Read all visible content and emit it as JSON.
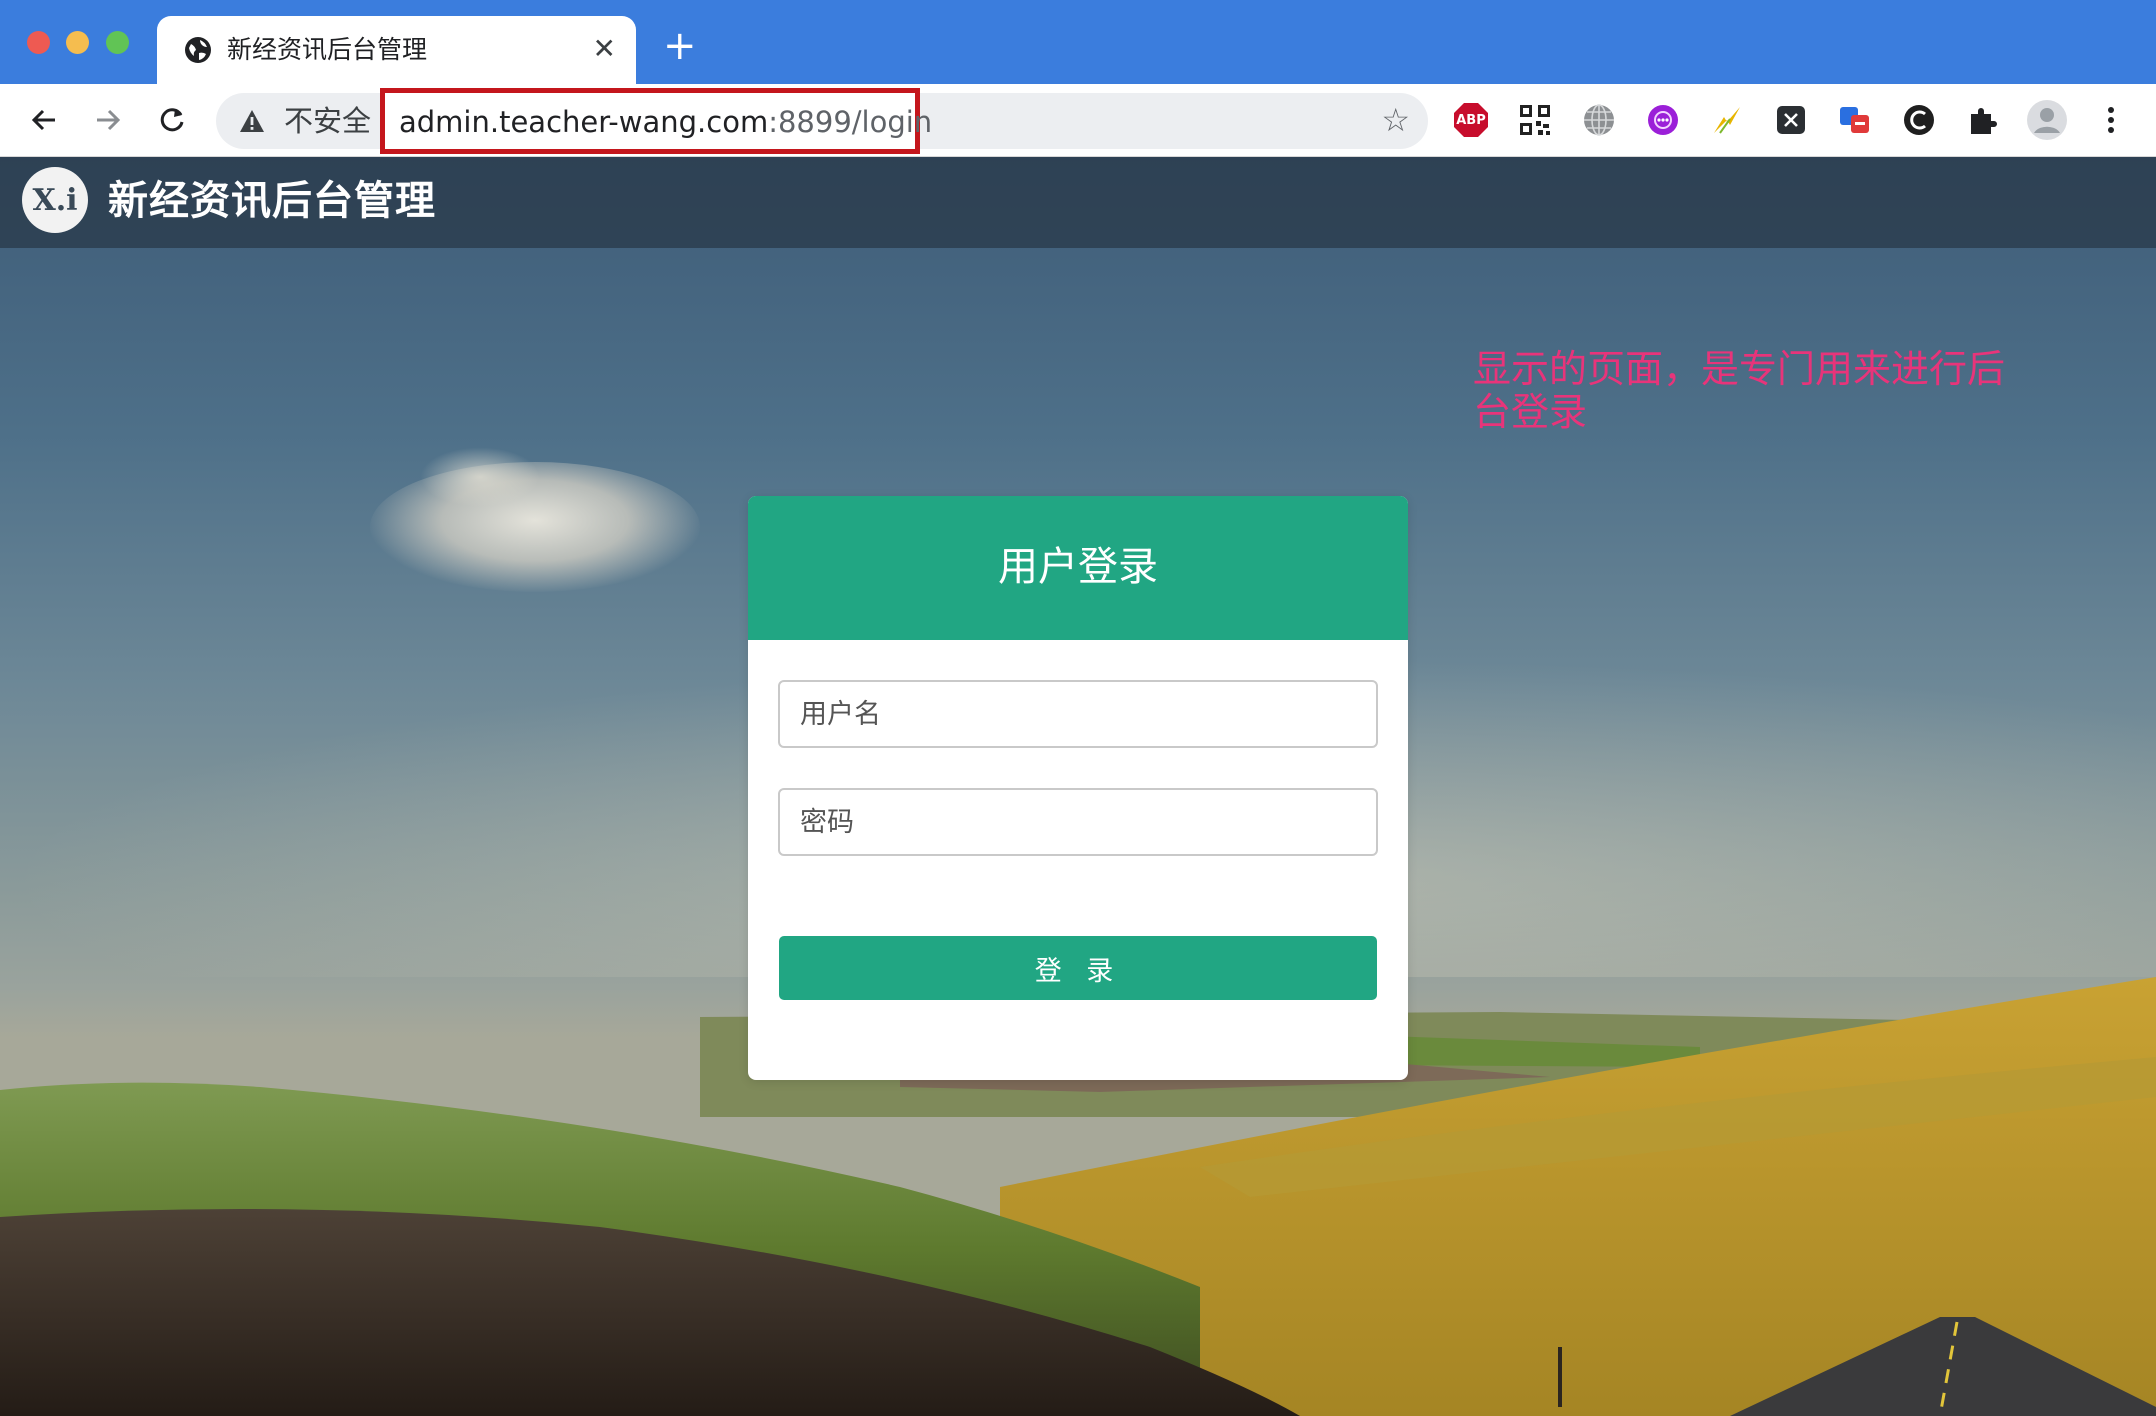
{
  "browser": {
    "tab_title": "新经资讯后台管理",
    "tab_close": "✕",
    "new_tab": "+",
    "security_label": "不安全",
    "url_host": "admin.teacher-wang.com",
    "url_rest": ":8899/login",
    "bookmark_icon": "☆",
    "extensions": [
      "abp-icon",
      "qr-code-icon",
      "globe-icon",
      "purple-extension-icon",
      "lightning-icon",
      "x-extension-icon",
      "translate-icon",
      "c-extension-icon",
      "puzzle-icon"
    ],
    "abp_label": "ABP"
  },
  "header": {
    "logo_text": "X.i",
    "title": "新经资讯后台管理"
  },
  "annotation": {
    "text": "显示的页面，是专门用来进行后台登录"
  },
  "login": {
    "title": "用户登录",
    "username_placeholder": "用户名",
    "password_placeholder": "密码",
    "submit_label": "登 录"
  },
  "colors": {
    "chrome_blue": "#3b7ddd",
    "accent_green": "#21a683",
    "annotation_pink": "#e8347a",
    "highlight_red": "#c4161c"
  }
}
